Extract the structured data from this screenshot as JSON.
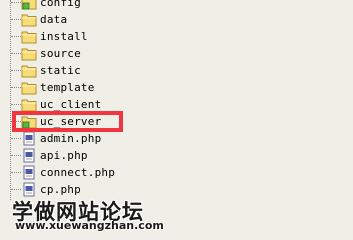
{
  "tree": {
    "items": [
      {
        "label": "config",
        "icon": "folder-new-icon"
      },
      {
        "label": "data",
        "icon": "folder-icon"
      },
      {
        "label": "install",
        "icon": "folder-icon"
      },
      {
        "label": "source",
        "icon": "folder-icon"
      },
      {
        "label": "static",
        "icon": "folder-icon"
      },
      {
        "label": "template",
        "icon": "folder-icon"
      },
      {
        "label": "uc_client",
        "icon": "folder-icon"
      },
      {
        "label": "uc_server",
        "icon": "folder-new-icon"
      },
      {
        "label": "admin.php",
        "icon": "php-file-icon"
      },
      {
        "label": "api.php",
        "icon": "php-file-icon"
      },
      {
        "label": "connect.php",
        "icon": "php-file-icon"
      },
      {
        "label": "cp.php",
        "icon": "php-file-icon"
      }
    ]
  },
  "highlight": {
    "color": "#f2363f",
    "target": "uc_server"
  },
  "watermark": {
    "title": "学做网站论坛",
    "url": "www.xuewangzhan.com"
  }
}
